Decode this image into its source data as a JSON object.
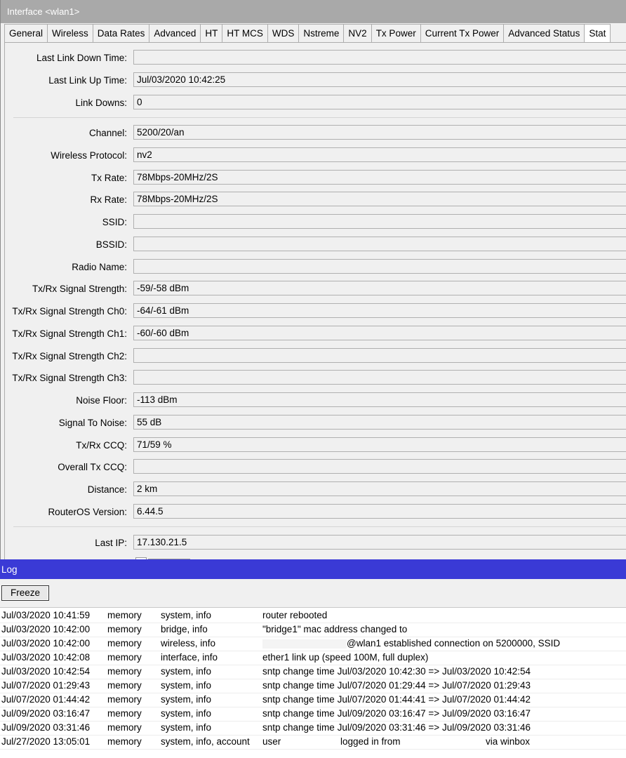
{
  "window": {
    "title": "Interface <wlan1>"
  },
  "tabs": [
    "General",
    "Wireless",
    "Data Rates",
    "Advanced",
    "HT",
    "HT MCS",
    "WDS",
    "Nstreme",
    "NV2",
    "Tx Power",
    "Current Tx Power",
    "Advanced Status",
    "Stat"
  ],
  "fields": [
    {
      "label": "Last Link Down Time:",
      "value": ""
    },
    {
      "label": "Last Link Up Time:",
      "value": "Jul/03/2020 10:42:25"
    },
    {
      "label": "Link Downs:",
      "value": "0"
    },
    {
      "label": "Channel:",
      "value": "5200/20/an"
    },
    {
      "label": "Wireless Protocol:",
      "value": "nv2"
    },
    {
      "label": "Tx Rate:",
      "value": "78Mbps-20MHz/2S"
    },
    {
      "label": "Rx Rate:",
      "value": "78Mbps-20MHz/2S"
    },
    {
      "label": "SSID:",
      "value": ""
    },
    {
      "label": "BSSID:",
      "value": ""
    },
    {
      "label": "Radio Name:",
      "value": ""
    },
    {
      "label": "Tx/Rx Signal Strength:",
      "value": "-59/-58 dBm"
    },
    {
      "label": "Tx/Rx Signal Strength Ch0:",
      "value": "-64/-61 dBm"
    },
    {
      "label": "Tx/Rx Signal Strength Ch1:",
      "value": "-60/-60 dBm"
    },
    {
      "label": "Tx/Rx Signal Strength Ch2:",
      "value": ""
    },
    {
      "label": "Tx/Rx Signal Strength Ch3:",
      "value": ""
    },
    {
      "label": "Noise Floor:",
      "value": "-113 dBm"
    },
    {
      "label": "Signal To Noise:",
      "value": "55 dB"
    },
    {
      "label": "Tx/Rx CCQ:",
      "value": "71/59 %"
    },
    {
      "label": "Overall Tx CCQ:",
      "value": ""
    },
    {
      "label": "Distance:",
      "value": "2 km"
    },
    {
      "label": "RouterOS Version:",
      "value": "6.44.5"
    },
    {
      "label": "Last IP:",
      "value": "17.130.21.5"
    }
  ],
  "log": {
    "title": "Log",
    "freeze_label": "Freeze",
    "rows": [
      {
        "time": "Jul/03/2020 10:41:59",
        "buffer": "memory",
        "topics": "system, info",
        "message": "router rebooted"
      },
      {
        "time": "Jul/03/2020 10:42:00",
        "buffer": "memory",
        "topics": "bridge, info",
        "message": "\"bridge1\" mac address changed to"
      },
      {
        "time": "Jul/03/2020 10:42:00",
        "buffer": "memory",
        "topics": "wireless, info",
        "message": "@wlan1 established connection on 5200000, SSID"
      },
      {
        "time": "Jul/03/2020 10:42:08",
        "buffer": "memory",
        "topics": "interface, info",
        "message": "ether1 link up (speed 100M, full duplex)"
      },
      {
        "time": "Jul/03/2020 10:42:54",
        "buffer": "memory",
        "topics": "system, info",
        "message": "sntp change time Jul/03/2020 10:42:30 => Jul/03/2020 10:42:54"
      },
      {
        "time": "Jul/07/2020 01:29:43",
        "buffer": "memory",
        "topics": "system, info",
        "message": "sntp change time Jul/07/2020 01:29:44 => Jul/07/2020 01:29:43"
      },
      {
        "time": "Jul/07/2020 01:44:42",
        "buffer": "memory",
        "topics": "system, info",
        "message": "sntp change time Jul/07/2020 01:44:41 => Jul/07/2020 01:44:42"
      },
      {
        "time": "Jul/09/2020 03:16:47",
        "buffer": "memory",
        "topics": "system, info",
        "message": "sntp change time Jul/09/2020 03:16:47 => Jul/09/2020 03:16:47"
      },
      {
        "time": "Jul/09/2020 03:31:46",
        "buffer": "memory",
        "topics": "system, info",
        "message": "sntp change time Jul/09/2020 03:31:46 => Jul/09/2020 03:31:46"
      },
      {
        "time": "Jul/27/2020 13:05:01",
        "buffer": "memory",
        "topics": "system, info, account",
        "message_parts": [
          "user",
          "logged in from",
          "via winbox"
        ]
      }
    ]
  }
}
